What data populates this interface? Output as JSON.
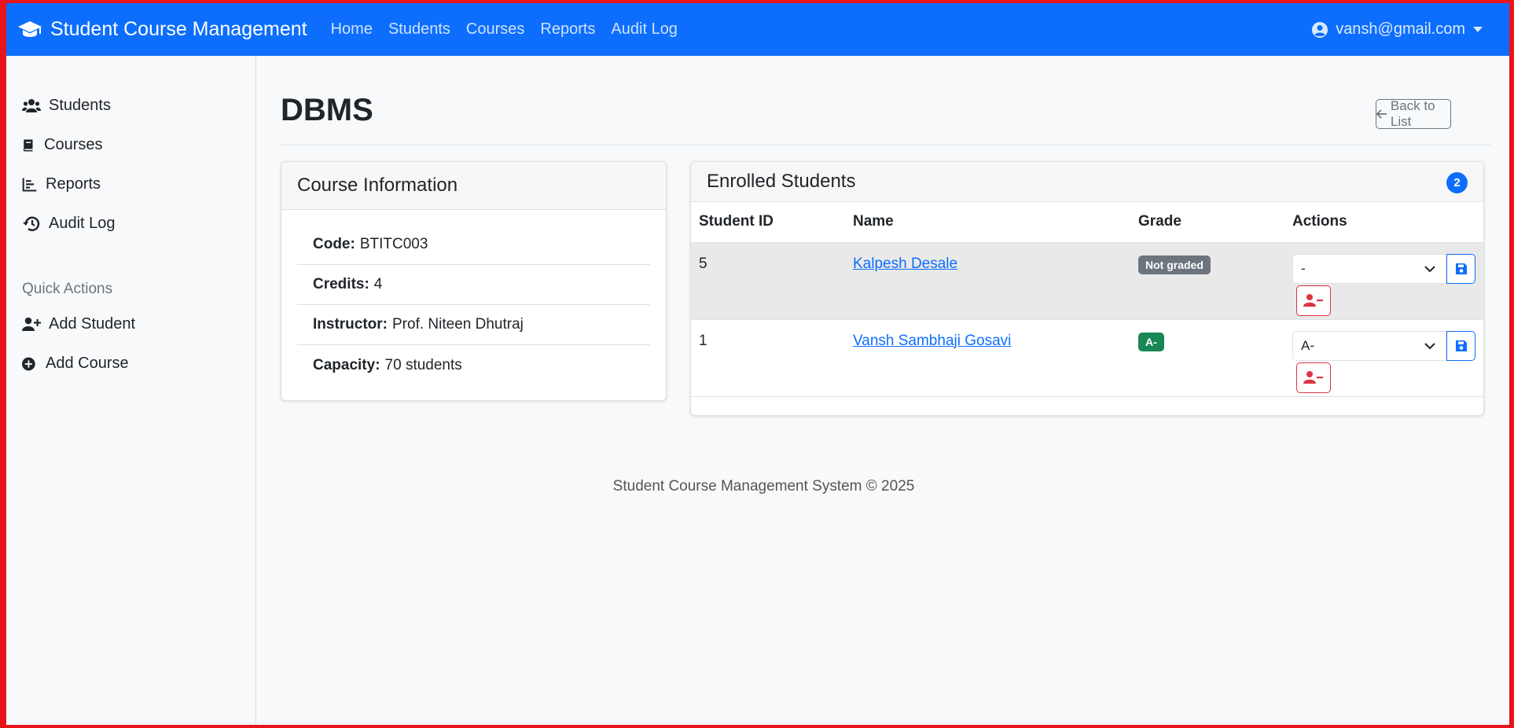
{
  "navbar": {
    "brand": "Student Course Management",
    "links": [
      "Home",
      "Students",
      "Courses",
      "Reports",
      "Audit Log"
    ],
    "user": "vansh@gmail.com"
  },
  "sidebar": {
    "items": [
      "Students",
      "Courses",
      "Reports",
      "Audit Log"
    ],
    "quick_actions_heading": "Quick Actions",
    "quick_actions": [
      "Add Student",
      "Add Course"
    ]
  },
  "page": {
    "title": "DBMS",
    "back_label": "Back to List"
  },
  "course_info": {
    "header": "Course Information",
    "code_label": "Code:",
    "code": "BTITC003",
    "credits_label": "Credits:",
    "credits": "4",
    "instructor_label": "Instructor:",
    "instructor": "Prof. Niteen Dhutraj",
    "capacity_label": "Capacity:",
    "capacity": "70 students"
  },
  "enrolled": {
    "header": "Enrolled Students",
    "count": "2",
    "columns": [
      "Student ID",
      "Name",
      "Grade",
      "Actions"
    ],
    "rows": [
      {
        "id": "5",
        "name": "Kalpesh Desale",
        "grade": "Not graded",
        "select_value": "-"
      },
      {
        "id": "1",
        "name": "Vansh Sambhaji Gosavi",
        "grade": "A-",
        "select_value": "A-"
      }
    ]
  },
  "footer": "Student Course Management System © 2025",
  "colors": {
    "primary": "#0d6efd",
    "secondary": "#6c757d",
    "success": "#198754",
    "danger": "#dc3545"
  }
}
